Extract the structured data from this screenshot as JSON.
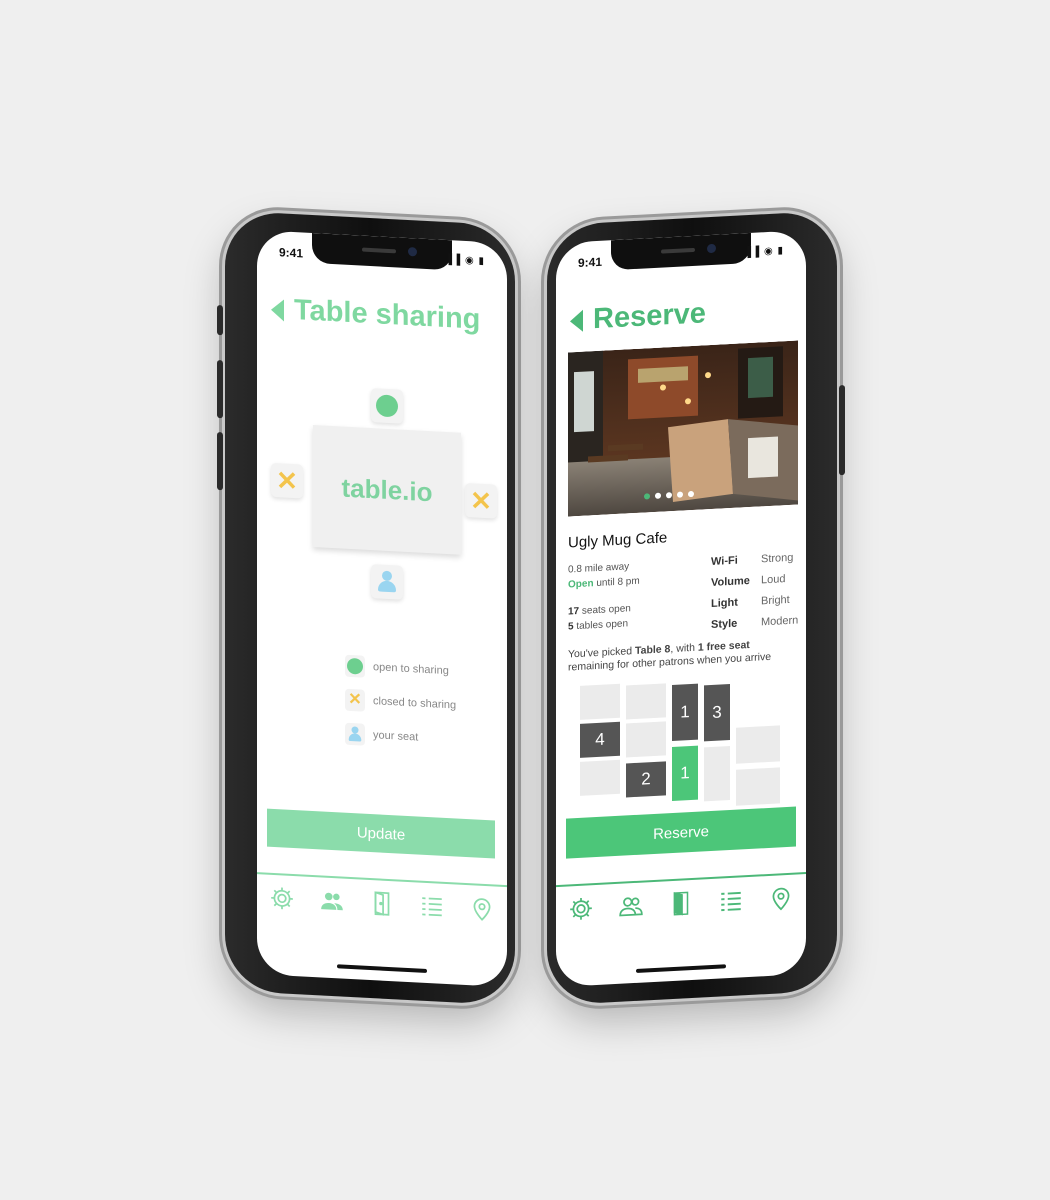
{
  "left_phone": {
    "status": {
      "time": "9:41",
      "icons": "▐▐ ◉ ▮"
    },
    "title": "Table sharing",
    "table_label": "table.io",
    "legend": [
      {
        "icon": "green-dot-icon",
        "label": "open to sharing"
      },
      {
        "icon": "x-mark-icon",
        "label": "closed to sharing"
      },
      {
        "icon": "person-icon",
        "label": "your seat"
      }
    ],
    "update_label": "Update",
    "nav_icons": [
      "settings-icon",
      "users-icon",
      "door-icon",
      "list-icon",
      "location-pin-icon"
    ]
  },
  "right_phone": {
    "status": {
      "time": "9:41",
      "icons": "▐▐ ◉ ▮"
    },
    "title": "Reserve",
    "cafe_name": "Ugly Mug Cafe",
    "distance": "0.8 mile away",
    "open_word": "Open",
    "open_until": "until 8 pm",
    "seats_count": "17",
    "seats_label": "seats open",
    "tables_count": "5",
    "tables_label": "tables open",
    "attributes": [
      {
        "key": "Wi-Fi",
        "value": "Strong"
      },
      {
        "key": "Volume",
        "value": "Loud"
      },
      {
        "key": "Light",
        "value": "Bright"
      },
      {
        "key": "Style",
        "value": "Modern"
      }
    ],
    "picked": {
      "prefix": "You've picked ",
      "table": "Table 8",
      "middle": ", with ",
      "seats": "1 free seat",
      "suffix": " remaining for other patrons when you arrive"
    },
    "table_numbers": {
      "a": "1",
      "b": "3",
      "c": "4",
      "d": "2",
      "e": "1"
    },
    "reserve_label": "Reserve",
    "carousel_dots": 5,
    "carousel_active": 1,
    "nav_icons": [
      "settings-icon",
      "users-icon",
      "door-icon",
      "list-icon",
      "location-pin-icon"
    ]
  },
  "colors": {
    "green": "#4cc679",
    "light_green": "#8bdcab",
    "yellow": "#f3c44c",
    "blue": "#9ad5f0",
    "dark": "#555555"
  }
}
